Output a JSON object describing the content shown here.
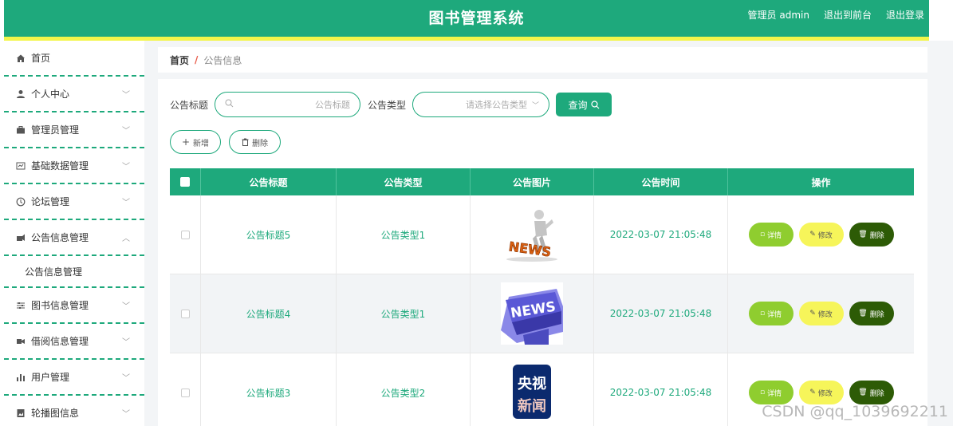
{
  "header": {
    "title": "图书管理系统",
    "user_label": "管理员 admin",
    "link_front": "退出到前台",
    "link_logout": "退出登录"
  },
  "sidebar": {
    "items": [
      {
        "label": "首页",
        "icon": "home-icon",
        "has_children": false
      },
      {
        "label": "个人中心",
        "icon": "user-icon",
        "has_children": true
      },
      {
        "label": "管理员管理",
        "icon": "briefcase-icon",
        "has_children": true
      },
      {
        "label": "基础数据管理",
        "icon": "data-icon",
        "has_children": true
      },
      {
        "label": "论坛管理",
        "icon": "compass-icon",
        "has_children": true
      },
      {
        "label": "公告信息管理",
        "icon": "megaphone-icon",
        "has_children": true,
        "expanded": true
      },
      {
        "label": "图书信息管理",
        "icon": "sliders-icon",
        "has_children": true
      },
      {
        "label": "借阅信息管理",
        "icon": "ticket-icon",
        "has_children": true
      },
      {
        "label": "用户管理",
        "icon": "bar-chart-icon",
        "has_children": true
      },
      {
        "label": "轮播图信息",
        "icon": "image-icon",
        "has_children": true
      }
    ],
    "sub_item": "公告信息管理"
  },
  "breadcrumb": {
    "home": "首页",
    "sep": "/",
    "current": "公告信息"
  },
  "search": {
    "title_label": "公告标题",
    "title_placeholder": "公告标题",
    "type_label": "公告类型",
    "type_placeholder": "请选择公告类型",
    "query_label": "查询"
  },
  "actions": {
    "add_label": "新增",
    "delete_label": "删除"
  },
  "table": {
    "headers": [
      "公告标题",
      "公告类型",
      "公告图片",
      "公告时间",
      "操作"
    ],
    "rows": [
      {
        "title": "公告标题5",
        "type": "公告类型1",
        "image": "news-figure",
        "time": "2022-03-07 21:05:48"
      },
      {
        "title": "公告标题4",
        "type": "公告类型1",
        "image": "news-keyboard",
        "time": "2022-03-07 21:05:48"
      },
      {
        "title": "公告标题3",
        "type": "公告类型2",
        "image": "cctv-news",
        "time": "2022-03-07 21:05:48"
      }
    ],
    "op_labels": {
      "detail": "详情",
      "edit": "修改",
      "remove": "删除"
    }
  },
  "thumb_text": {
    "news": "NEWS",
    "cctv_line1": "央视",
    "cctv_line2": "新闻"
  },
  "watermark": "CSDN @qq_1039692211",
  "colors": {
    "primary": "#1ea97c",
    "accent_yellow": "#f3f54a",
    "detail": "#8fcd2f",
    "edit": "#f6f55a",
    "remove": "#2d5b06"
  }
}
